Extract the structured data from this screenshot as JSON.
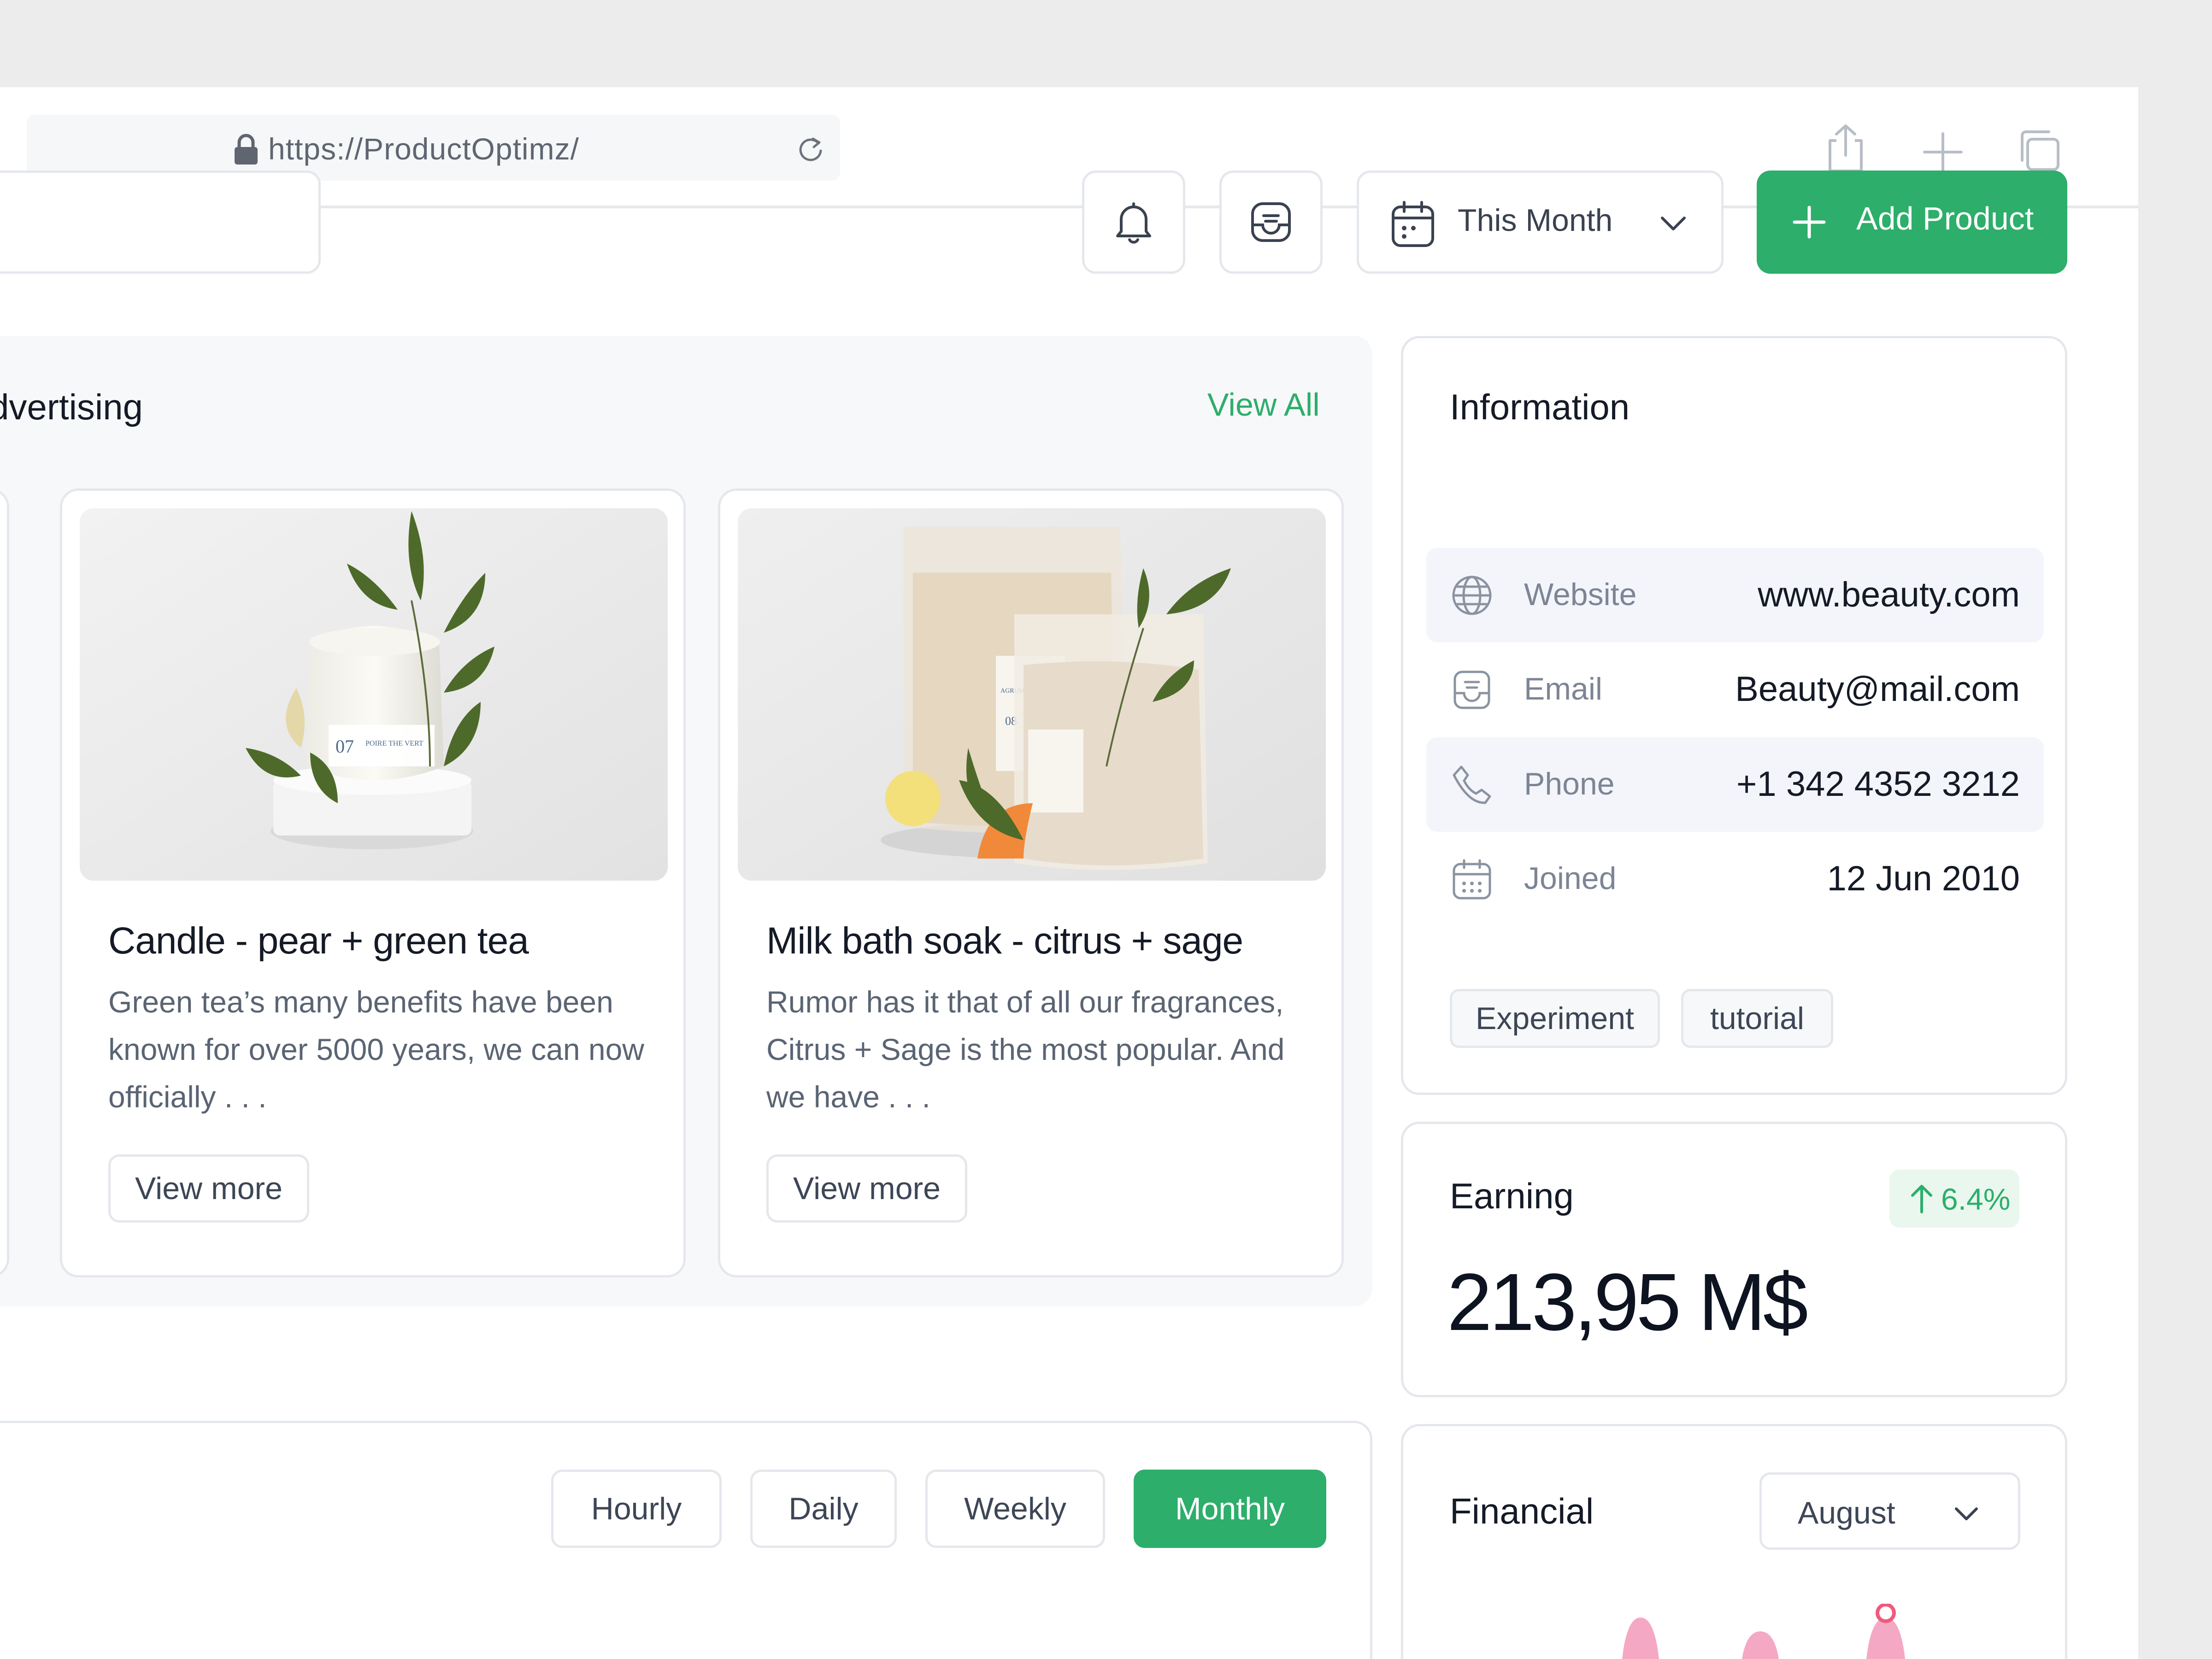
{
  "browser": {
    "url": "https://ProductOptimz/"
  },
  "toolbar": {
    "date_filter": "This Month",
    "add_label": "Add Product"
  },
  "advertising": {
    "title": "Advertising",
    "view_all": "View All",
    "products": [
      {
        "title": "Candle - pear + green tea",
        "description": "Green tea’s many benefits have been known for over 5000 years, we can now officially . . .",
        "button": "View more",
        "jar_label_number": "07",
        "jar_label_text": "POIRE THE VERT"
      },
      {
        "title": "Milk bath soak - citrus + sage",
        "description": "Rumor has it that of all our fragrances, Citrus + Sage is the most popular. And we have . . .",
        "button": "View more",
        "pouch_label_text": "AGRUMES SAUGE",
        "pouch_label_number": "08"
      }
    ]
  },
  "information": {
    "title": "Information",
    "rows": [
      {
        "key": "Website",
        "value": "www.beauty.com",
        "icon": "globe-icon"
      },
      {
        "key": "Email",
        "value": "Beauty@mail.com",
        "icon": "inbox-icon"
      },
      {
        "key": "Phone",
        "value": "+1 342 4352 3212",
        "icon": "phone-icon"
      },
      {
        "key": "Joined",
        "value": "12 Jun 2010",
        "icon": "calendar-icon"
      }
    ],
    "tags": [
      "Experiment",
      "tutorial"
    ]
  },
  "earning": {
    "title": "Earning",
    "change": "6.4%",
    "value": "213,95 M$"
  },
  "chart_controls": {
    "periods": [
      "Hourly",
      "Daily",
      "Weekly",
      "Monthly"
    ],
    "active": "Monthly"
  },
  "financial": {
    "title": "Financial",
    "month": "August"
  },
  "colors": {
    "accent": "#2dae6b",
    "border": "#e4e7ec",
    "panel_bg": "#f7f8fa",
    "row_highlight": "#f3f5fb",
    "chart_pink": "#f5a8c4",
    "chart_marker": "#ef5a7c"
  }
}
